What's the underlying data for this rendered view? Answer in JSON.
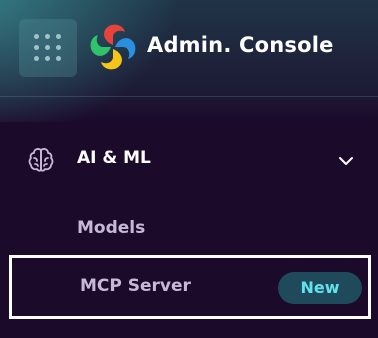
{
  "header": {
    "app_title": "Admin. Console",
    "apps_icon": "grid-icon",
    "logo_icon": "pinwheel-logo"
  },
  "nav": {
    "section": {
      "label": "AI & ML",
      "icon": "brain-icon",
      "expanded": true
    },
    "items": [
      {
        "label": "Models",
        "selected": false
      },
      {
        "label": "MCP Server",
        "selected": true,
        "badge": "New"
      }
    ]
  },
  "colors": {
    "background": "#1c0a2b",
    "teal_glow": "#368088",
    "sub_item_text": "#c6b8d6",
    "badge_bg": "#1e4a5c",
    "badge_text": "#63e1ea",
    "logo_red": "#e8433a",
    "logo_yellow": "#f5c518",
    "logo_green": "#2fc46a",
    "logo_blue": "#2a8fe0"
  }
}
